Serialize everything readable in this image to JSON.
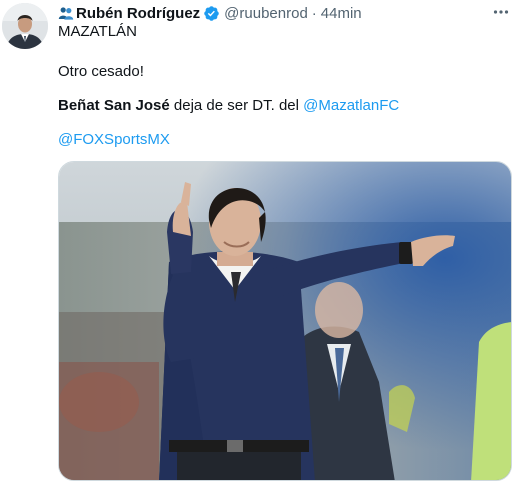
{
  "author": {
    "name": "Rubén Rodríguez",
    "handle": "@ruubenrod",
    "separator": "·",
    "time": "44min",
    "icons": [
      "people-icon",
      "verified-badge-icon",
      "more-icon"
    ]
  },
  "tweet": {
    "line1": "MAZATLÁN",
    "line2": "Otro cesado!",
    "line3_bold": "Beñat San José",
    "line3_text": " deja de ser DT. del ",
    "line3_mention": "@MazatlanFC",
    "line4_mention": "@FOXSportsMX"
  },
  "colors": {
    "accent": "#1d9bf0",
    "secondary_text": "#536471",
    "text": "#0f1419"
  }
}
